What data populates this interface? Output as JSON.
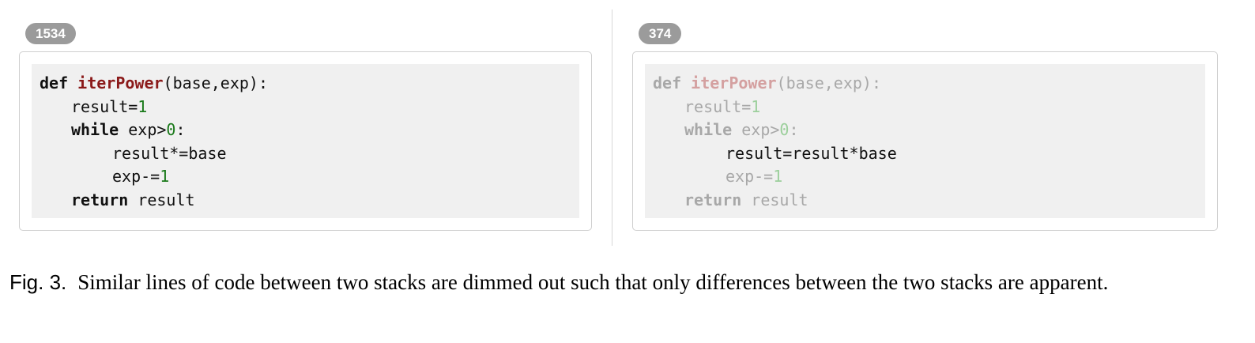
{
  "stacks": [
    {
      "count": "1534",
      "lines": [
        [
          {
            "t": "def ",
            "c": "kw"
          },
          {
            "t": "iterPower",
            "c": "fn"
          },
          {
            "t": "(base,exp):",
            "c": "plain"
          }
        ],
        [
          {
            "t": "result=",
            "c": "plain"
          },
          {
            "t": "1",
            "c": "num"
          }
        ],
        [
          {
            "t": "while ",
            "c": "kw"
          },
          {
            "t": "exp>",
            "c": "plain"
          },
          {
            "t": "0",
            "c": "num"
          },
          {
            "t": ":",
            "c": "plain"
          }
        ],
        [
          {
            "t": "result*=base",
            "c": "plain"
          }
        ],
        [
          {
            "t": "exp-=",
            "c": "plain"
          },
          {
            "t": "1",
            "c": "num"
          }
        ],
        [
          {
            "t": "return ",
            "c": "kw"
          },
          {
            "t": "result",
            "c": "plain"
          }
        ]
      ],
      "dimmed": [
        false,
        false,
        false,
        false,
        false,
        false
      ]
    },
    {
      "count": "374",
      "lines": [
        [
          {
            "t": "def ",
            "c": "kw"
          },
          {
            "t": "iterPower",
            "c": "fn"
          },
          {
            "t": "(base,exp):",
            "c": "plain"
          }
        ],
        [
          {
            "t": "result=",
            "c": "plain"
          },
          {
            "t": "1",
            "c": "num"
          }
        ],
        [
          {
            "t": "while ",
            "c": "kw"
          },
          {
            "t": "exp>",
            "c": "plain"
          },
          {
            "t": "0",
            "c": "num"
          },
          {
            "t": ":",
            "c": "plain"
          }
        ],
        [
          {
            "t": "result=result*base",
            "c": "plain"
          }
        ],
        [
          {
            "t": "exp-=",
            "c": "plain"
          },
          {
            "t": "1",
            "c": "num"
          }
        ],
        [
          {
            "t": "return ",
            "c": "kw"
          },
          {
            "t": "result",
            "c": "plain"
          }
        ]
      ],
      "dimmed": [
        true,
        true,
        true,
        false,
        true,
        true
      ]
    }
  ],
  "caption": {
    "label": "Fig. 3.",
    "text": "Similar lines of code between two stacks are dimmed out such that only differences between the two stacks are apparent."
  },
  "colors": {
    "keyword": "#111111",
    "function_name": "#8b1a1a",
    "number": "#1a7a1a",
    "badge": "#9b9b9b",
    "code_background": "#f0f0f0"
  }
}
